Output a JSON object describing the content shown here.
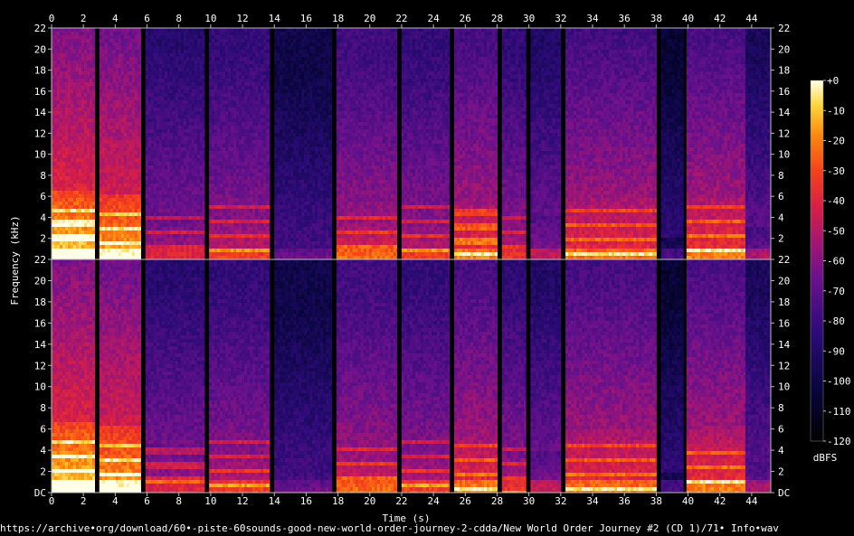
{
  "chart_data": {
    "type": "heatmap",
    "xlabel": "Time (s)",
    "ylabel": "Frequency (kHz)",
    "xlim": [
      0,
      45.2
    ],
    "ylim": [
      0,
      22
    ],
    "x_ticks": [
      0,
      2,
      4,
      6,
      8,
      10,
      12,
      14,
      16,
      18,
      20,
      22,
      24,
      26,
      28,
      30,
      32,
      34,
      36,
      38,
      40,
      42,
      44
    ],
    "y_ticks": [
      2,
      4,
      6,
      8,
      10,
      12,
      14,
      16,
      18,
      20,
      22
    ],
    "y_tick_labels_left_top": [
      "2",
      "4",
      "6",
      "8",
      "10",
      "12",
      "14",
      "16",
      "18",
      "20",
      "22"
    ],
    "y_tick_labels_left_bottom": [
      "DC",
      "2",
      "4",
      "6",
      "8",
      "10",
      "12",
      "14",
      "16",
      "18",
      "20",
      "22"
    ],
    "channels": 2,
    "colorbar": {
      "label": "dBFS",
      "range": [
        -120,
        0
      ],
      "ticks": [
        "+0",
        "-10",
        "-20",
        "-30",
        "-40",
        "-50",
        "-60",
        "-70",
        "-80",
        "-90",
        "-100",
        "-110",
        "-120"
      ]
    },
    "segments": [
      {
        "start": 0.0,
        "end": 2.7,
        "level": 0.95,
        "bw": 6.5
      },
      {
        "start": 3.0,
        "end": 5.6,
        "level": 0.9,
        "bw": 6.3
      },
      {
        "start": 5.9,
        "end": 9.6,
        "level": 0.55,
        "bw": 4.5
      },
      {
        "start": 9.9,
        "end": 13.7,
        "level": 0.62,
        "bw": 4.0
      },
      {
        "start": 14.0,
        "end": 17.6,
        "level": 0.35,
        "bw": 1.2
      },
      {
        "start": 17.9,
        "end": 21.7,
        "level": 0.7,
        "bw": 3.0
      },
      {
        "start": 22.0,
        "end": 25.0,
        "level": 0.62,
        "bw": 3.8
      },
      {
        "start": 25.3,
        "end": 28.0,
        "level": 0.72,
        "bw": 5.0
      },
      {
        "start": 28.3,
        "end": 29.8,
        "level": 0.6,
        "bw": 4.0
      },
      {
        "start": 30.1,
        "end": 32.0,
        "level": 0.5,
        "bw": 4.0
      },
      {
        "start": 32.3,
        "end": 38.0,
        "level": 0.7,
        "bw": 6.0
      },
      {
        "start": 38.3,
        "end": 39.7,
        "level": 0.25,
        "bw": 2.0
      },
      {
        "start": 39.9,
        "end": 43.6,
        "level": 0.72,
        "bw": 6.0
      },
      {
        "start": 43.6,
        "end": 45.2,
        "level": 0.45,
        "bw": 3.0
      }
    ]
  },
  "footer_path": "https://archive•org/download/60•-piste-60sounds-good-new-world-order-journey-2-cdda/New World Order Journey #2 (CD 1)/71• Info•wav"
}
